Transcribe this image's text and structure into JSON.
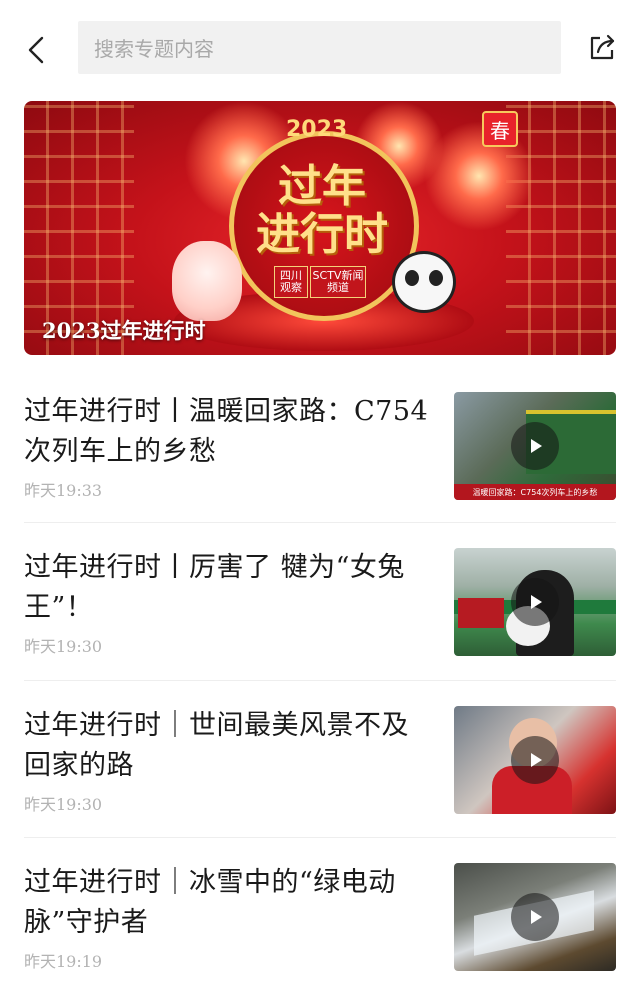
{
  "search": {
    "placeholder": "搜索专题内容"
  },
  "banner": {
    "caption": "2023过年进行时",
    "year": "2023",
    "main_title_line1": "过年",
    "main_title_line2": "进行时",
    "badge": "春",
    "logo1": "四川观察",
    "logo2": "SCTV新闻频道"
  },
  "articles": [
    {
      "title": "过年进行时丨温暖回家路：C754次列车上的乡愁",
      "time": "昨天19:33",
      "thumb_caption": "温暖回家路：C754次列车上的乡愁",
      "has_video": true
    },
    {
      "title": "过年进行时丨厉害了 犍为“女兔王”！",
      "time": "昨天19:30",
      "has_video": true
    },
    {
      "title": "过年进行时｜世间最美风景不及回家的路",
      "time": "昨天19:30",
      "has_video": true
    },
    {
      "title": "过年进行时｜冰雪中的“绿电动脉”守护者",
      "time": "昨天19:19",
      "has_video": true
    }
  ],
  "icons": {
    "back": "back-arrow-icon",
    "share": "share-icon",
    "play": "play-icon"
  },
  "colors": {
    "search_bg": "#f1f1f1",
    "time_text": "#b3b3b3",
    "banner_red": "#c4121a"
  }
}
